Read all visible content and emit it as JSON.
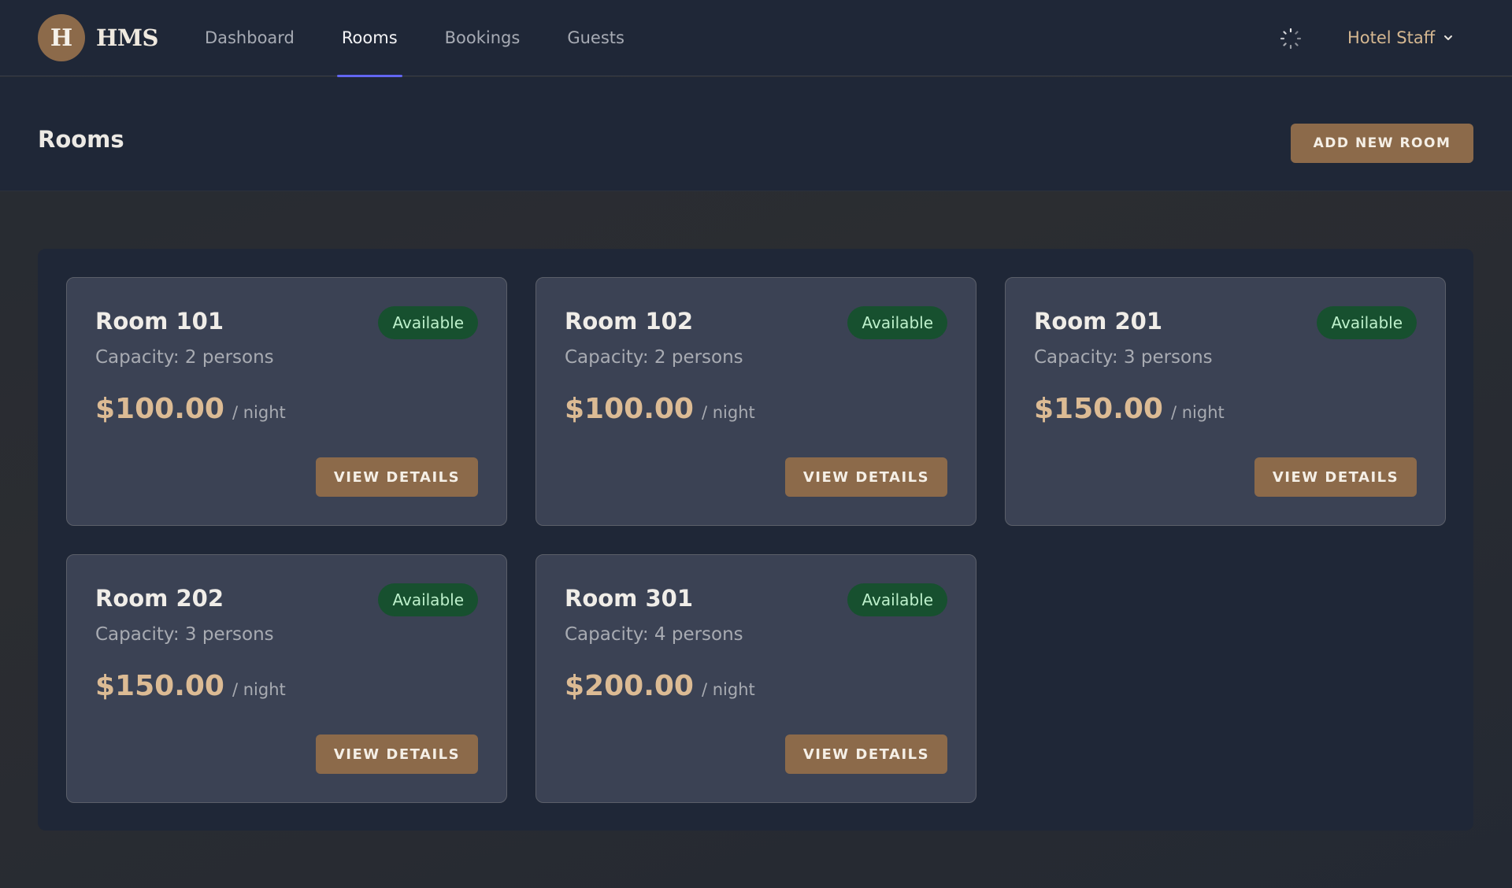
{
  "app": {
    "logo_letter": "H",
    "logo_text": "HMS"
  },
  "nav": {
    "items": [
      {
        "label": "Dashboard",
        "active": false
      },
      {
        "label": "Rooms",
        "active": true
      },
      {
        "label": "Bookings",
        "active": false
      },
      {
        "label": "Guests",
        "active": false
      }
    ],
    "user_label": "Hotel Staff",
    "icons": {
      "loading": "spinner-icon",
      "user_menu": "chevron-down-icon"
    }
  },
  "page": {
    "title": "Rooms",
    "add_button_label": "ADD NEW ROOM"
  },
  "rooms": [
    {
      "name": "Room 101",
      "status": "Available",
      "capacity": "Capacity: 2 persons",
      "price": "$100.00",
      "per": "/ night",
      "button": "VIEW DETAILS"
    },
    {
      "name": "Room 102",
      "status": "Available",
      "capacity": "Capacity: 2 persons",
      "price": "$100.00",
      "per": "/ night",
      "button": "VIEW DETAILS"
    },
    {
      "name": "Room 201",
      "status": "Available",
      "capacity": "Capacity: 3 persons",
      "price": "$150.00",
      "per": "/ night",
      "button": "VIEW DETAILS"
    },
    {
      "name": "Room 202",
      "status": "Available",
      "capacity": "Capacity: 3 persons",
      "price": "$150.00",
      "per": "/ night",
      "button": "VIEW DETAILS"
    },
    {
      "name": "Room 301",
      "status": "Available",
      "capacity": "Capacity: 4 persons",
      "price": "$200.00",
      "per": "/ night",
      "button": "VIEW DETAILS"
    }
  ],
  "colors": {
    "accent_brown": "#8c6a4a",
    "nav_active_underline": "#6266f1",
    "badge_available_bg": "#17502f",
    "badge_available_text": "#bdf0cb",
    "price_text": "#dcbb94",
    "card_bg": "#3b4254",
    "panel_bg": "#1f2737"
  }
}
